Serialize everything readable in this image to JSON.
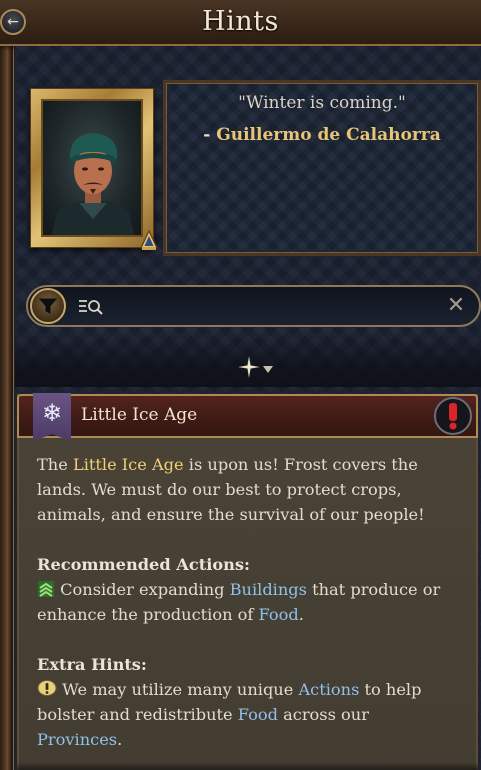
{
  "header": {
    "title": "Hints",
    "back_icon": "arrow-left-icon"
  },
  "character": {
    "quote": "\"Winter is coming.\"",
    "author_prefix": "- ",
    "author": "Guillermo de Calahorra"
  },
  "search": {
    "placeholder": "",
    "value": ""
  },
  "hint": {
    "title": "Little Ice Age",
    "icon": "snowflake-icon",
    "alert_icon": "exclamation-icon",
    "intro": {
      "pre": "The ",
      "keyword": "Little Ice Age",
      "post": " is upon us! Frost covers the lands. We must do our best to protect crops, animals, and ensure the survival of our people!"
    },
    "recommended": {
      "heading": "Recommended Actions:",
      "pre": " Consider expanding ",
      "link1": "Buildings",
      "mid": " that produce or enhance the production of ",
      "link2": "Food",
      "post": "."
    },
    "extra": {
      "heading": "Extra Hints:",
      "pre": " We may utilize many unique ",
      "link1": "Actions",
      "mid": " to help bolster and redistribute ",
      "link2": "Food",
      "mid2": " across our ",
      "link3": "Provinces",
      "post": "."
    }
  },
  "colors": {
    "keyword_gold": "#f0cf7a",
    "link_blue": "#8fc0ea",
    "header_red": "#4a2019"
  }
}
